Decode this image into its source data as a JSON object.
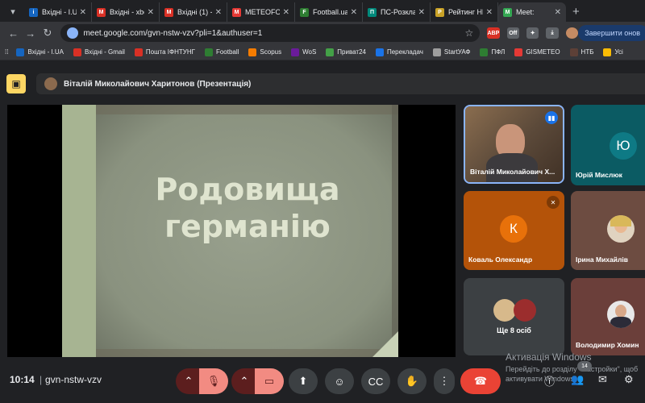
{
  "browser": {
    "tabs": [
      {
        "title": "Вхідні - I.UA",
        "fav_color": "#1565c0",
        "fav_letter": "i"
      },
      {
        "title": "Вхідні - xbo",
        "fav_color": "#d93025",
        "fav_letter": "M"
      },
      {
        "title": "Вхідні (1) -",
        "fav_color": "#d93025",
        "fav_letter": "M"
      },
      {
        "title": "METEOFOR",
        "fav_color": "#e53935",
        "fav_letter": "M"
      },
      {
        "title": "Football.ua",
        "fav_color": "#2e7d32",
        "fav_letter": "F"
      },
      {
        "title": "ПС-Розкла",
        "fav_color": "#00897b",
        "fav_letter": "П"
      },
      {
        "title": "Рейтинг НП",
        "fav_color": "#c9a227",
        "fav_letter": "Р"
      },
      {
        "title": "Meet:",
        "fav_color": "#34a853",
        "fav_letter": "M"
      }
    ],
    "url": "meet.google.com/gvn-nstw-vzv?pli=1&authuser=1",
    "finish_button": "Завершити онов",
    "bookmarks": [
      {
        "label": "Вхідні - I.UA",
        "color": "#1565c0"
      },
      {
        "label": "Вхідні - Gmail",
        "color": "#d93025"
      },
      {
        "label": "Пошта ІФНТУНГ",
        "color": "#d93025"
      },
      {
        "label": "Football",
        "color": "#2e7d32"
      },
      {
        "label": "Scopus",
        "color": "#f57c00"
      },
      {
        "label": "WoS",
        "color": "#6a1b9a"
      },
      {
        "label": "Приват24",
        "color": "#43a047"
      },
      {
        "label": "Перекладач",
        "color": "#1a73e8"
      },
      {
        "label": "StartУАФ",
        "color": "#9e9e9e"
      },
      {
        "label": "ПФЛ",
        "color": "#2e7d32"
      },
      {
        "label": "GISMETEO",
        "color": "#e53935"
      },
      {
        "label": "НТБ",
        "color": "#5d4037"
      },
      {
        "label": "Усі",
        "color": "#fbbc04"
      }
    ]
  },
  "meet": {
    "presenter_title": "Віталій Миколайович Харитонов (Презентація)",
    "slide": {
      "line1": "Родовища",
      "line2": "германію"
    },
    "participants": [
      {
        "name": "Віталій Миколайович Х...",
        "kind": "video"
      },
      {
        "name": "Юрій Мислюк",
        "letter": "Ю",
        "color": "#0e7a85"
      },
      {
        "name": "Коваль Олександр",
        "letter": "К",
        "color": "#e8710a",
        "muted": true
      },
      {
        "name": "Ірина Михайлів",
        "kind": "photo"
      },
      {
        "name": "Ще 8 осіб",
        "kind": "group"
      },
      {
        "name": "Володимир Хомин",
        "kind": "photo"
      }
    ],
    "time": "10:14",
    "meeting_code": "gvn-nstw-vzv",
    "people_count": "14",
    "watermark_title": "Активація Windows",
    "watermark_text": "Перейдіть до розділу \"Настройки\", щоб активувати Windows."
  }
}
